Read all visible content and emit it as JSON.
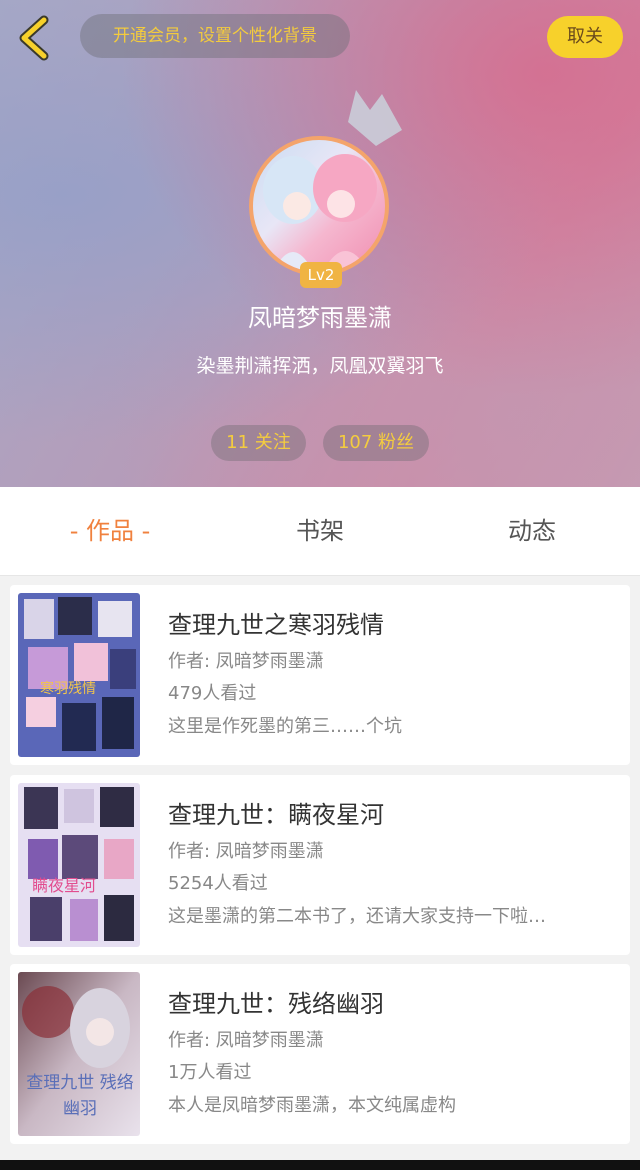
{
  "header": {
    "vip_promo": "开通会员，设置个性化背景",
    "unfollow_label": "取关",
    "level": "Lv2",
    "username": "凤暗梦雨墨潇",
    "signature": "染墨荆潇挥洒，凤凰双翼羽飞",
    "following": "11 关注",
    "fans": "107 粉丝",
    "icons": [
      "back-icon",
      "crown-icon"
    ]
  },
  "tabs": [
    {
      "label": "- 作品 -",
      "active": true
    },
    {
      "label": "书架",
      "active": false
    },
    {
      "label": "动态",
      "active": false
    }
  ],
  "books": [
    {
      "title": "查理九世之寒羽残情",
      "author": "作者: 凤暗梦雨墨潇",
      "views": "479人看过",
      "desc": "这里是作死墨的第三……个坑"
    },
    {
      "title": "查理九世：瞒夜星河",
      "author": "作者: 凤暗梦雨墨潇",
      "views": "5254人看过",
      "desc": "这是墨潇的第二本书了，还请大家支持一下啦…"
    },
    {
      "title": "查理九世：残络幽羽",
      "author": "作者: 凤暗梦雨墨潇",
      "views": "1万人看过",
      "desc": "本人是凤暗梦雨墨潇，本文纯属虚构",
      "cover_text": "查理九世 残络幽羽"
    }
  ],
  "colors": {
    "accent": "#f0813e",
    "gold": "#f4cc3f",
    "button_yellow": "#f7d12b"
  }
}
